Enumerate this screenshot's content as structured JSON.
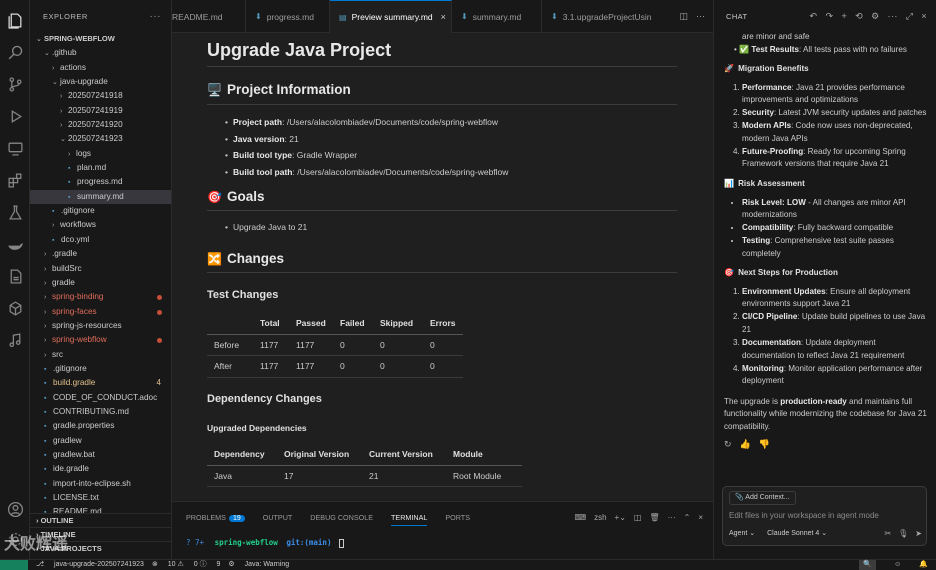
{
  "sidebar": {
    "header": "EXPLORER",
    "tree": [
      {
        "label": "SPRING-WEBFLOW",
        "indent": 0,
        "chev": "⌄",
        "kind": "root"
      },
      {
        "label": ".github",
        "indent": 1,
        "chev": "⌄"
      },
      {
        "label": "actions",
        "indent": 2,
        "chev": "›"
      },
      {
        "label": "java-upgrade",
        "indent": 2,
        "chev": "⌄"
      },
      {
        "label": "20250724191​8",
        "indent": 3,
        "chev": "›"
      },
      {
        "label": "20250724191​9",
        "indent": 3,
        "chev": "›"
      },
      {
        "label": "20250724192​0",
        "indent": 3,
        "chev": "›"
      },
      {
        "label": "20250724192​3",
        "indent": 3,
        "chev": "⌄"
      },
      {
        "label": "logs",
        "indent": 4,
        "chev": "›"
      },
      {
        "label": "plan.md",
        "indent": 4,
        "file": true
      },
      {
        "label": "progress.md",
        "indent": 4,
        "file": true
      },
      {
        "label": "summary.md",
        "indent": 4,
        "file": true,
        "selected": true
      },
      {
        "label": ".gitignore",
        "indent": 2,
        "file": true
      },
      {
        "label": "workflows",
        "indent": 2,
        "chev": "›"
      },
      {
        "label": "dco.yml",
        "indent": 2,
        "file": true
      },
      {
        "label": ".gradle",
        "indent": 1,
        "chev": "›"
      },
      {
        "label": "buildSrc",
        "indent": 1,
        "chev": "›"
      },
      {
        "label": "gradle",
        "indent": 1,
        "chev": "›"
      },
      {
        "label": "spring-binding",
        "indent": 1,
        "chev": "›",
        "color": "red",
        "dot": true
      },
      {
        "label": "spring-faces",
        "indent": 1,
        "chev": "›",
        "color": "red",
        "dot": true
      },
      {
        "label": "spring-js-resources",
        "indent": 1,
        "chev": "›"
      },
      {
        "label": "spring-webflow",
        "indent": 1,
        "chev": "›",
        "color": "red",
        "dot": true
      },
      {
        "label": "src",
        "indent": 1,
        "chev": "›"
      },
      {
        "label": ".gitignore",
        "indent": 1,
        "file": true
      },
      {
        "label": "build.gradle",
        "indent": 1,
        "file": true,
        "color": "yel",
        "count": "4"
      },
      {
        "label": "CODE_OF_CONDUCT.adoc",
        "indent": 1,
        "file": true
      },
      {
        "label": "CONTRIBUTING.md",
        "indent": 1,
        "file": true
      },
      {
        "label": "gradle.properties",
        "indent": 1,
        "file": true
      },
      {
        "label": "gradlew",
        "indent": 1,
        "file": true
      },
      {
        "label": "gradlew.bat",
        "indent": 1,
        "file": true
      },
      {
        "label": "ide.gradle",
        "indent": 1,
        "file": true
      },
      {
        "label": "import-into-eclipse.sh",
        "indent": 1,
        "file": true
      },
      {
        "label": "LICENSE.txt",
        "indent": 1,
        "file": true
      },
      {
        "label": "README.md",
        "indent": 1,
        "file": true
      }
    ],
    "sections": [
      "OUTLINE",
      "TIMELINE",
      "JAVA PROJECTS"
    ]
  },
  "tabs": [
    {
      "label": "README.md",
      "active": false
    },
    {
      "label": "progress.md",
      "active": false
    },
    {
      "label": "Preview summary.md",
      "active": true
    },
    {
      "label": "summary.md",
      "active": false
    },
    {
      "label": "3.1.upgradeProjectUsin",
      "active": false
    }
  ],
  "doc": {
    "title": "Upgrade Java Project",
    "project_info": {
      "emoji": "🖥️",
      "heading": "Project Information",
      "items": [
        {
          "k": "Project path",
          "v": "/Users/alacolombiadev/Documents/code/spring-webflow"
        },
        {
          "k": "Java version",
          "v": "21"
        },
        {
          "k": "Build tool type",
          "v": "Gradle Wrapper"
        },
        {
          "k": "Build tool path",
          "v": "/Users/alacolombiadev/Documents/code/spring-webflow"
        }
      ]
    },
    "goals": {
      "emoji": "🎯",
      "heading": "Goals",
      "items": [
        "Upgrade Java to 21"
      ]
    },
    "changes": {
      "emoji": "🔀",
      "heading": "Changes"
    },
    "test_changes": {
      "heading": "Test Changes",
      "columns": [
        "",
        "Total",
        "Passed",
        "Failed",
        "Skipped",
        "Errors"
      ],
      "rows": [
        [
          "Before",
          "1177",
          "1177",
          "0",
          "0",
          "0"
        ],
        [
          "After",
          "1177",
          "1177",
          "0",
          "0",
          "0"
        ]
      ]
    },
    "dependency_changes": {
      "heading": "Dependency Changes",
      "subheading": "Upgraded Dependencies",
      "columns": [
        "Dependency",
        "Original Version",
        "Current Version",
        "Module"
      ],
      "rows": [
        [
          "Java",
          "17",
          "21",
          "Root Module"
        ]
      ]
    }
  },
  "panel": {
    "tabs": [
      {
        "label": "PROBLEMS",
        "badge": "19"
      },
      {
        "label": "OUTPUT"
      },
      {
        "label": "DEBUG CONSOLE"
      },
      {
        "label": "TERMINAL",
        "active": true
      },
      {
        "label": "PORTS"
      }
    ],
    "shell": "zsh",
    "prompt_prefix": "? 7+",
    "prompt_dir": "spring-webflow",
    "prompt_git": "git:(main)"
  },
  "chat": {
    "header": "CHAT",
    "top_lines": [
      {
        "text": "are minor and safe",
        "bold": ""
      },
      {
        "bold": "Test Results",
        "text": ": All tests pass with no failures",
        "emoji": "✅"
      }
    ],
    "sections": [
      {
        "emoji": "🚀",
        "title": "Migration Benefits",
        "ordered": true,
        "items": [
          {
            "b": "Performance",
            "t": ": Java 21 provides performance improvements and optimizations"
          },
          {
            "b": "Security",
            "t": ": Latest JVM security updates and patches"
          },
          {
            "b": "Modern APIs",
            "t": ": Code now uses non-deprecated, modern Java APIs"
          },
          {
            "b": "Future-Proofing",
            "t": ": Ready for upcoming Spring Framework versions that require Java 21"
          }
        ]
      },
      {
        "emoji": "📊",
        "title": "Risk Assessment",
        "ordered": false,
        "items": [
          {
            "b": "Risk Level: LOW",
            "t": " - All changes are minor API modernizations"
          },
          {
            "b": "Compatibility",
            "t": ": Fully backward compatible"
          },
          {
            "b": "Testing",
            "t": ": Comprehensive test suite passes completely"
          }
        ]
      },
      {
        "emoji": "🎯",
        "title": "Next Steps for Production",
        "ordered": true,
        "items": [
          {
            "b": "Environment Updates",
            "t": ": Ensure all deployment environments support Java 21"
          },
          {
            "b": "CI/CD Pipeline",
            "t": ": Update build pipelines to use Java 21"
          },
          {
            "b": "Documentation",
            "t": ": Update deployment documentation to reflect Java 21 requirement"
          },
          {
            "b": "Monitoring",
            "t": ": Monitor application performance after deployment"
          }
        ]
      }
    ],
    "closing_pre": "The upgrade is ",
    "closing_bold": "production-ready",
    "closing_post": " and maintains full functionality while modernizing the codebase for Java 21 compatibility.",
    "add_context": "Add Context...",
    "input_placeholder": "Edit files in your workspace in agent mode",
    "mode": "Agent",
    "model": "Claude Sonnet 4"
  },
  "status": {
    "branch": "java-upgrade-20250724192​3",
    "errors": "10",
    "warnings": "0",
    "info": "9",
    "java": "Java: Warning"
  },
  "watermark": "大败辉遥"
}
